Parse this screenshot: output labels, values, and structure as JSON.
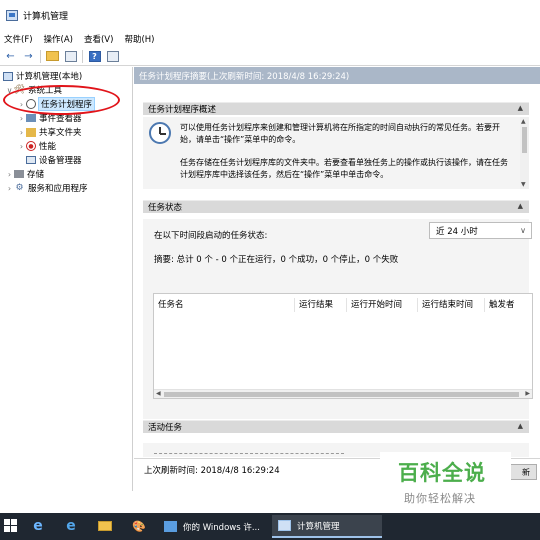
{
  "window": {
    "title": "计算机管理"
  },
  "menu": [
    "文件(F)",
    "操作(A)",
    "查看(V)",
    "帮助(H)"
  ],
  "tree": {
    "root": "计算机管理(本地)",
    "system_tools": "系统工具",
    "task_scheduler": "任务计划程序",
    "event_viewer": "事件查看器",
    "shared_folders": "共享文件夹",
    "performance": "性能",
    "device_manager": "设备管理器",
    "storage": "存储",
    "services": "服务和应用程序"
  },
  "main": {
    "header": "任务计划程序摘要(上次刷新时间: 2018/4/8 16:29:24)",
    "overview": {
      "title": "任务计划程序概述",
      "para1": "可以使用任务计划程序来创建和管理计算机将在所指定的时间自动执行的常见任务。若要开始，请单击“操作”菜单中的命令。",
      "para2": "任务存储在任务计划程序库的文件夹中。若要查看单独任务上的操作或执行该操作，请在任务计划程序库中选择该任务，然后在“操作”菜单中单击命令。"
    },
    "task_status": {
      "title": "任务状态",
      "label": "在以下时间段启动的任务状态:",
      "period": "近 24 小时",
      "summary": "摘要: 总计 0 个 - 0 个正在运行，0 个成功，0 个停止，0 个失败",
      "columns": [
        "任务名",
        "运行结果",
        "运行开始时间",
        "运行结束时间",
        "触发者"
      ]
    },
    "active_tasks": {
      "title": "活动任务"
    },
    "last_refresh": "上次刷新时间: 2018/4/8 16:29:24",
    "refresh_button": "新"
  },
  "watermark": {
    "title": "百科全说",
    "subtitle": "助你轻松解决"
  },
  "taskbar": {
    "task1": "你的 Windows 许...",
    "task2": "计算机管理"
  },
  "colors": {
    "accent_red": "#e1141a",
    "header_strip": "#aab7c8",
    "taskbar": "#1f2731",
    "watermark_green": "#4cae4c"
  }
}
